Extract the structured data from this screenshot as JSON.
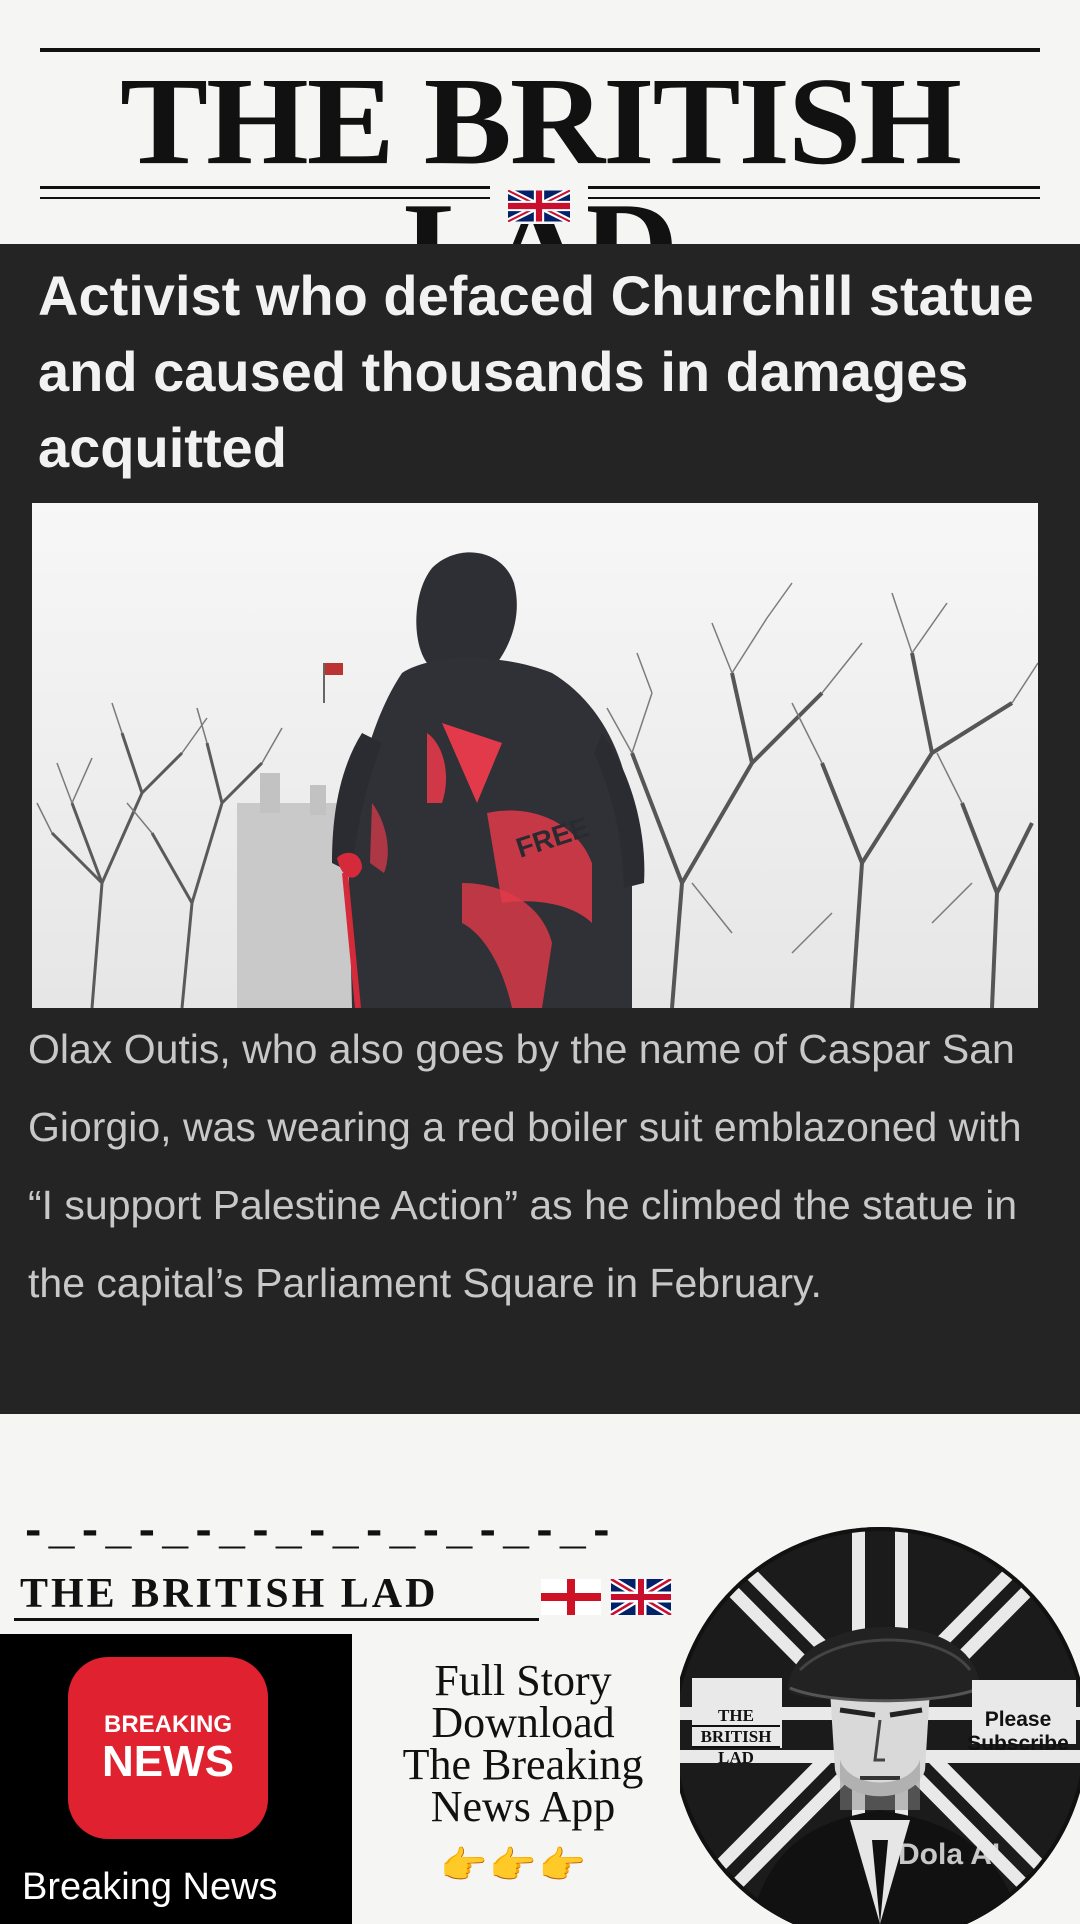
{
  "masthead": {
    "title": "THE BRITISH LAD"
  },
  "article": {
    "headline": "Activist who defaced Churchill statue and caused thousands in damages acquitted",
    "image_alt": "Churchill statue defaced with red paint",
    "statue_graffiti": "FREE",
    "body": "Olax Outis, who also goes by the name of Caspar San Giorgio, was wearing a red boiler suit emblazoned with “I support Palestine Action” as he climbed the statue in the capital’s Parliament Square in February."
  },
  "footer": {
    "dash_row": "-_-_-_-_-_-_-_-_-_-_-",
    "title": "THE BRITISH LAD",
    "app_icon": {
      "line1": "BREAKING",
      "line2": "NEWS"
    },
    "app_label": "Breaking News",
    "cta": [
      "Full Story",
      "Download",
      "The Breaking",
      "News App"
    ],
    "cta_hands": "👉👉👉",
    "badge": {
      "left_text": [
        "THE",
        "BRITISH",
        "LAD"
      ],
      "right_text": [
        "Please",
        "Subscribe"
      ],
      "watermark": "Dola AI"
    }
  },
  "colors": {
    "card_bg": "#242424",
    "breaking_red": "#e0212f",
    "paint_red": "#e23a4a"
  }
}
